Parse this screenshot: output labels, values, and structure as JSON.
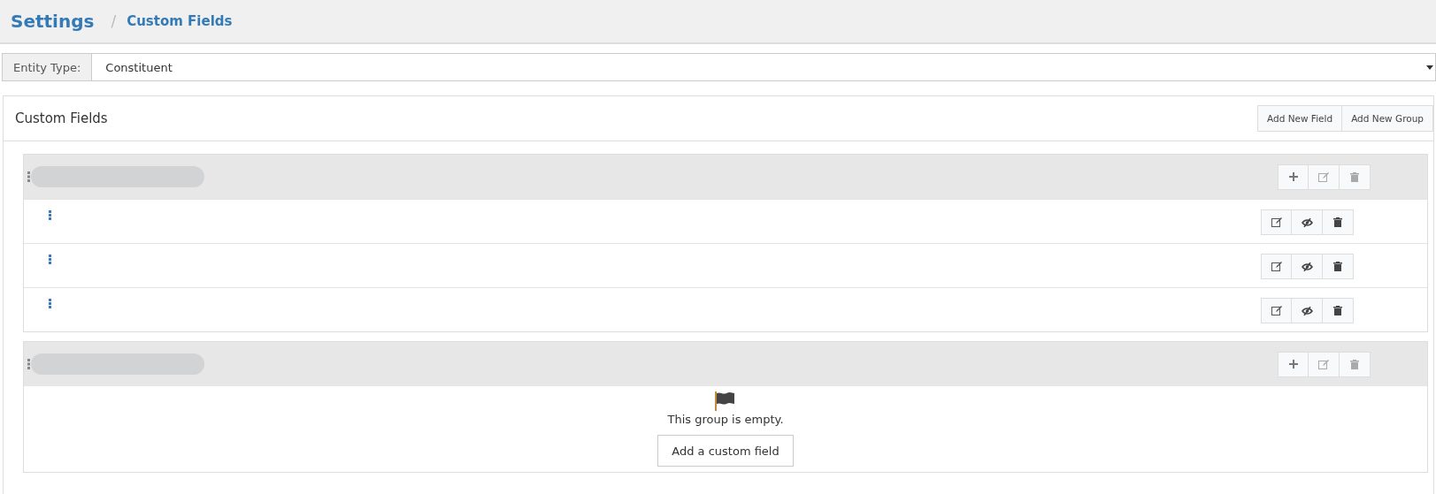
{
  "breadcrumb": {
    "root": "Settings",
    "separator": "/",
    "current": "Custom Fields"
  },
  "entity_type": {
    "label": "Entity Type:",
    "value": "Constituent"
  },
  "panel": {
    "title": "Custom Fields",
    "buttons": [
      "Add New Field",
      "Add New Group"
    ]
  },
  "groups": [
    {
      "fields": [
        {
          "kind": "field"
        },
        {
          "kind": "field"
        },
        {
          "kind": "field"
        }
      ]
    },
    {
      "empty_message": "This group is empty.",
      "add_button": "Add a custom field"
    }
  ]
}
